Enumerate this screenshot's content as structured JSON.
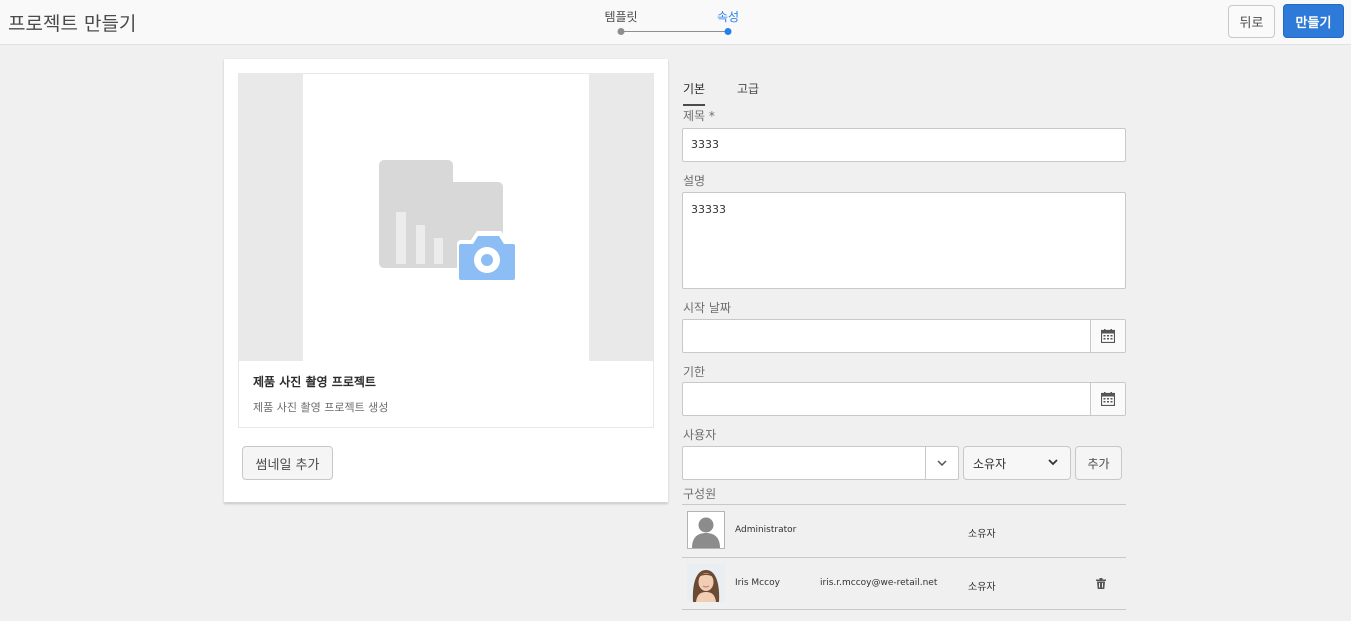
{
  "header": {
    "title": "프로젝트 만들기",
    "steps": [
      {
        "label": "템플릿",
        "active": false
      },
      {
        "label": "속성",
        "active": true
      }
    ],
    "back_label": "뒤로",
    "create_label": "만들기"
  },
  "template": {
    "title": "제품 사진 촬영 프로젝트",
    "description": "제품 사진 촬영 프로젝트 생성",
    "add_thumbnail_label": "썸네일 추가"
  },
  "tabs": [
    "기본",
    "고급"
  ],
  "form": {
    "title_label": "제목",
    "title_value": "3333",
    "description_label": "설명",
    "description_value": "33333",
    "start_date_label": "시작 날짜",
    "start_date_value": "",
    "due_label": "기한",
    "due_value": "",
    "user_label": "사용자",
    "user_value": "",
    "role_value": "소유자",
    "add_label": "추가",
    "members_label": "구성원"
  },
  "members": [
    {
      "name": "Administrator",
      "email": "",
      "role": "소유자"
    },
    {
      "name": "Iris Mccoy",
      "email": "iris.r.mccoy@we-retail.net",
      "role": "소유자"
    }
  ],
  "colors": {
    "accent": "#2d7ad8",
    "camera": "#8dbdf5"
  }
}
